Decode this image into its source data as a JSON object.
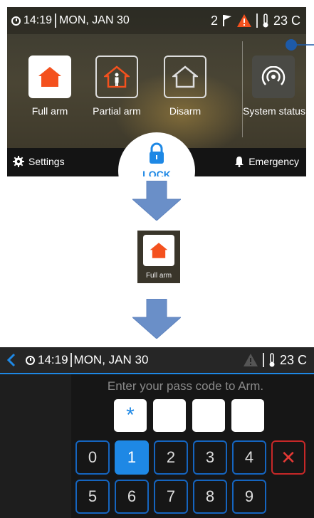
{
  "screen1": {
    "time": "14:19",
    "date": "MON, JAN 30",
    "alert_count": "2",
    "temperature": "23 C",
    "arm_options": [
      {
        "label": "Full arm",
        "icon": "house-filled-icon"
      },
      {
        "label": "Partial arm",
        "icon": "house-person-icon"
      },
      {
        "label": "Disarm",
        "icon": "house-outline-icon"
      }
    ],
    "system_status_label": "System status",
    "settings_label": "Settings",
    "lock_label": "LOCK",
    "emergency_label": "Emergency"
  },
  "mini_button": {
    "label": "Full arm"
  },
  "screen3": {
    "time": "14:19",
    "date": "MON, JAN 30",
    "temperature": "23 C",
    "prompt": "Enter your pass code to Arm.",
    "entered_digits": [
      "*",
      "",
      "",
      ""
    ],
    "keypad_row1": [
      "0",
      "1",
      "2",
      "3",
      "4"
    ],
    "keypad_row2": [
      "5",
      "6",
      "7",
      "8",
      "9"
    ],
    "active_key": "1",
    "delete_symbol": "✕"
  },
  "colors": {
    "accent": "#1e88e5",
    "house_orange": "#f4511e",
    "warning": "#f4511e",
    "delete_red": "#e53935"
  }
}
